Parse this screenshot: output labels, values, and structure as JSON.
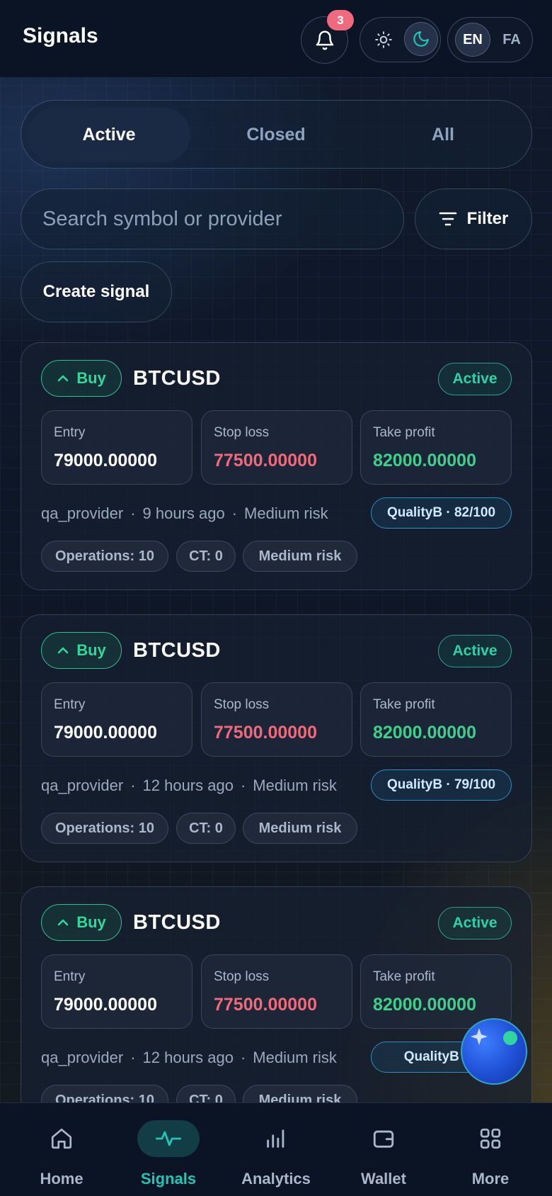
{
  "header": {
    "title": "Signals",
    "notification_count": "3",
    "lang_en": "EN",
    "lang_fa": "FA"
  },
  "tabs": [
    {
      "label": "Active",
      "selected": true
    },
    {
      "label": "Closed",
      "selected": false
    },
    {
      "label": "All",
      "selected": false
    }
  ],
  "search": {
    "placeholder": "Search symbol or provider",
    "value": ""
  },
  "filter_label": "Filter",
  "create_label": "Create signal",
  "labels": {
    "entry": "Entry",
    "stop_loss": "Stop loss",
    "take_profit": "Take profit"
  },
  "signals": [
    {
      "side": "Buy",
      "symbol": "BTCUSD",
      "status": "Active",
      "entry": "79000.00000",
      "stop_loss": "77500.00000",
      "take_profit": "82000.00000",
      "provider": "qa_provider",
      "time": "9 hours ago",
      "risk": "Medium risk",
      "quality": "QualityB · 82/100",
      "chips": [
        "Operations: 10",
        "CT: 0",
        "Medium risk"
      ]
    },
    {
      "side": "Buy",
      "symbol": "BTCUSD",
      "status": "Active",
      "entry": "79000.00000",
      "stop_loss": "77500.00000",
      "take_profit": "82000.00000",
      "provider": "qa_provider",
      "time": "12 hours ago",
      "risk": "Medium risk",
      "quality": "QualityB · 79/100",
      "chips": [
        "Operations: 10",
        "CT: 0",
        "Medium risk"
      ]
    },
    {
      "side": "Buy",
      "symbol": "BTCUSD",
      "status": "Active",
      "entry": "79000.00000",
      "stop_loss": "77500.00000",
      "take_profit": "82000.00000",
      "provider": "qa_provider",
      "time": "12 hours ago",
      "risk": "Medium risk",
      "quality": "QualityB · 7",
      "chips": [
        "Operations: 10",
        "CT: 0",
        "Medium risk"
      ]
    }
  ],
  "nav": [
    {
      "label": "Home",
      "icon": "home-icon"
    },
    {
      "label": "Signals",
      "icon": "pulse-icon",
      "active": true
    },
    {
      "label": "Analytics",
      "icon": "bar-chart-icon"
    },
    {
      "label": "Wallet",
      "icon": "wallet-icon"
    },
    {
      "label": "More",
      "icon": "grid-icon"
    }
  ],
  "colors": {
    "accent": "#22c5b4",
    "buy": "#33d69a",
    "stop_loss": "#f06a7a",
    "take_profit": "#3fcf8a",
    "badge": "#f06a7f"
  }
}
